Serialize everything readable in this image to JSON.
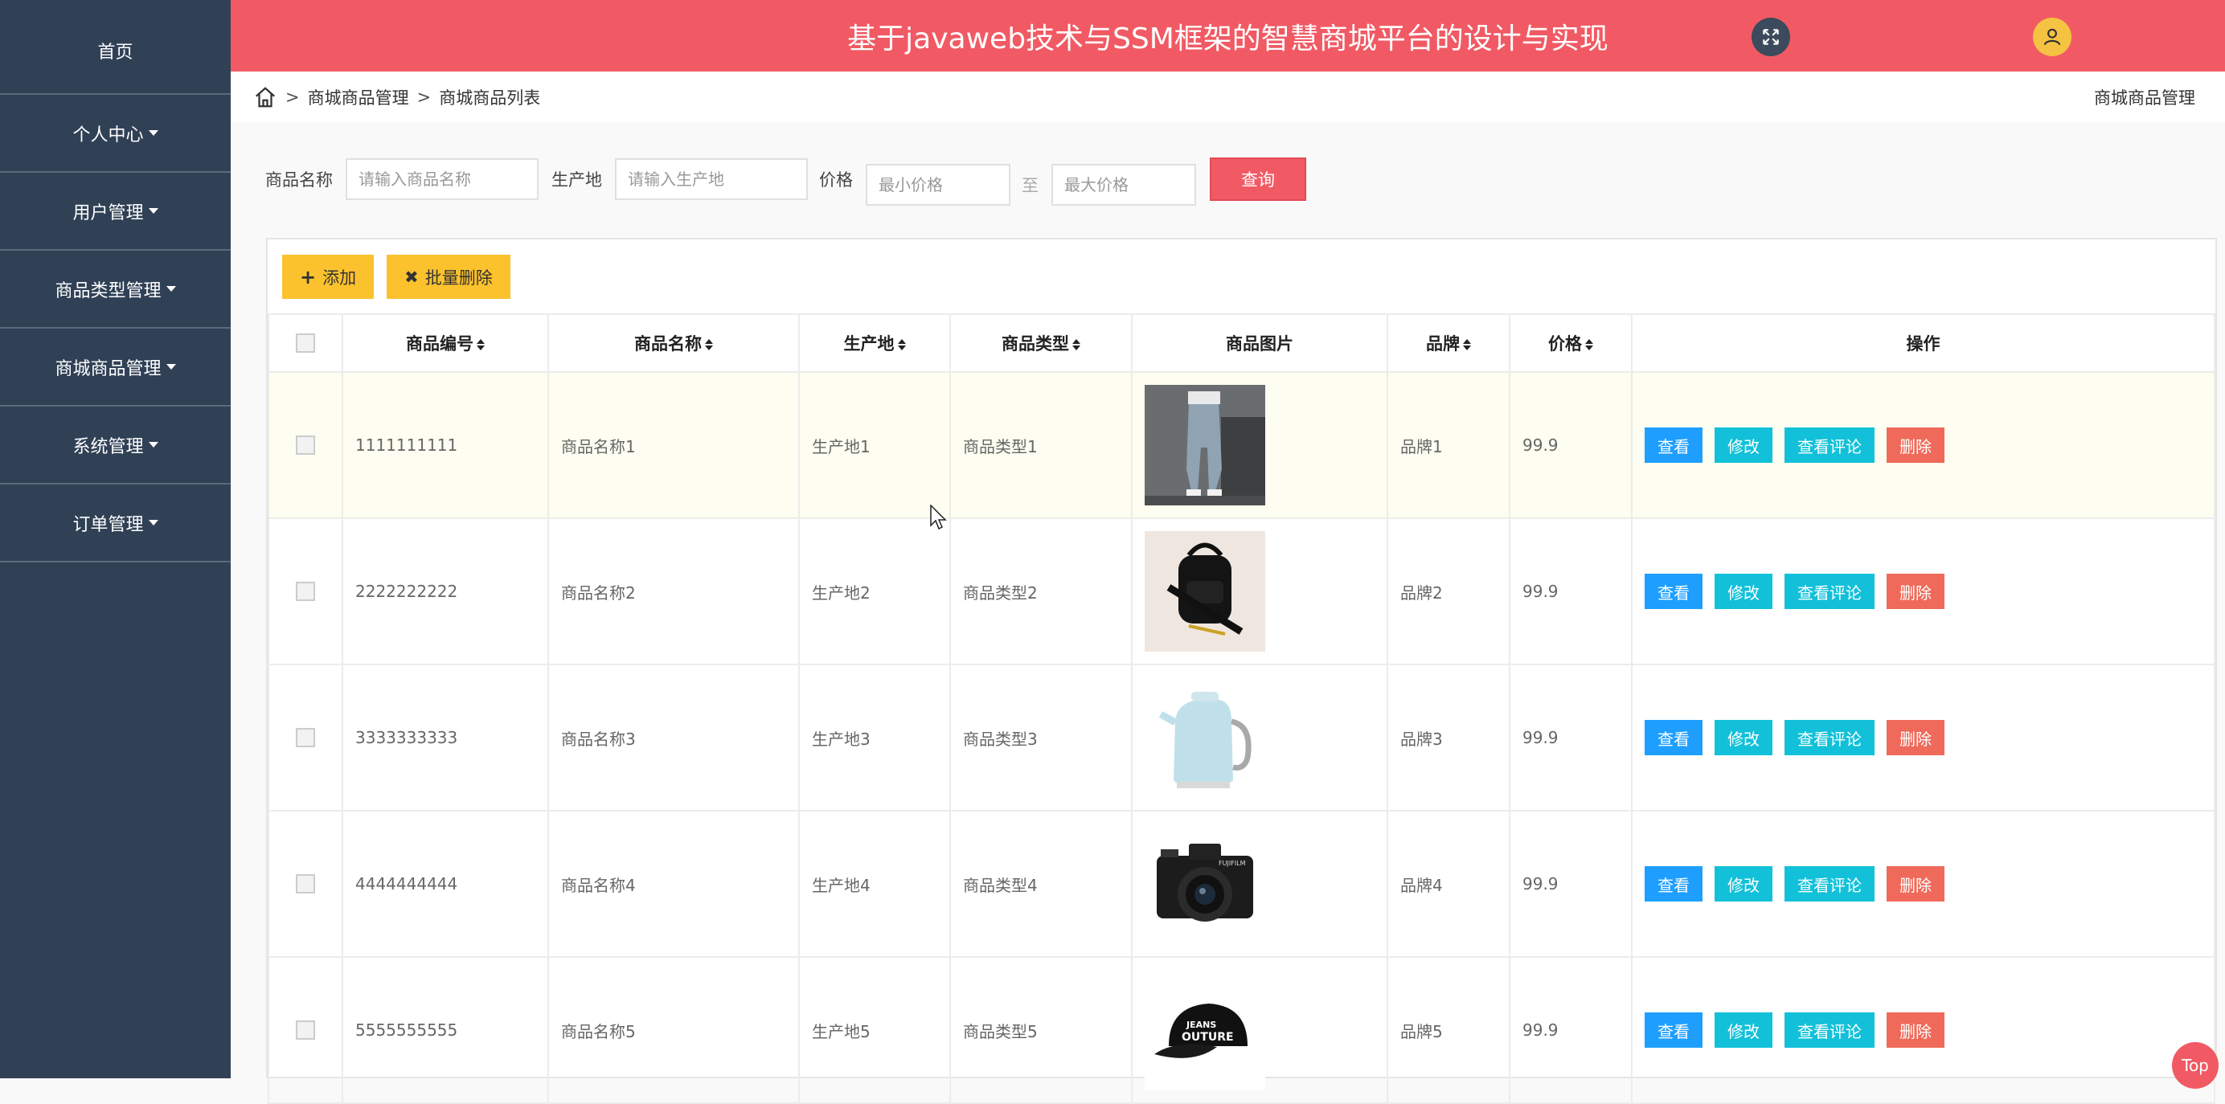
{
  "header": {
    "title": "基于javaweb技术与SSM框架的智慧商城平台的设计与实现"
  },
  "sidebar": {
    "items": [
      {
        "label": "首页",
        "dropdown": false
      },
      {
        "label": "个人中心",
        "dropdown": true
      },
      {
        "label": "用户管理",
        "dropdown": true
      },
      {
        "label": "商品类型管理",
        "dropdown": true
      },
      {
        "label": "商城商品管理",
        "dropdown": true
      },
      {
        "label": "系统管理",
        "dropdown": true
      },
      {
        "label": "订单管理",
        "dropdown": true
      }
    ]
  },
  "breadcrumb": {
    "items": [
      "商城商品管理",
      "商城商品列表"
    ],
    "separator": ">",
    "right": "商城商品管理"
  },
  "search": {
    "name_label": "商品名称",
    "name_placeholder": "请输入商品名称",
    "origin_label": "生产地",
    "origin_placeholder": "请输入生产地",
    "price_label": "价格",
    "min_placeholder": "最小价格",
    "to_label": "至",
    "max_placeholder": "最大价格",
    "query_button": "查询"
  },
  "actions": {
    "add_label": "添加",
    "batch_delete_label": "批量删除"
  },
  "table": {
    "headers": {
      "code": "商品编号",
      "name": "商品名称",
      "origin": "生产地",
      "type": "商品类型",
      "image": "商品图片",
      "brand": "品牌",
      "price": "价格",
      "ops": "操作"
    },
    "op_labels": {
      "view": "查看",
      "edit": "修改",
      "comments": "查看评论",
      "delete": "删除"
    },
    "rows": [
      {
        "code": "1111111111",
        "name": "商品名称1",
        "origin": "生产地1",
        "type": "商品类型1",
        "brand": "品牌1",
        "price": "99.9",
        "image": "jeans"
      },
      {
        "code": "2222222222",
        "name": "商品名称2",
        "origin": "生产地2",
        "type": "商品类型2",
        "brand": "品牌2",
        "price": "99.9",
        "image": "bag"
      },
      {
        "code": "3333333333",
        "name": "商品名称3",
        "origin": "生产地3",
        "type": "商品类型3",
        "brand": "品牌3",
        "price": "99.9",
        "image": "kettle"
      },
      {
        "code": "4444444444",
        "name": "商品名称4",
        "origin": "生产地4",
        "type": "商品类型4",
        "brand": "品牌4",
        "price": "99.9",
        "image": "camera"
      },
      {
        "code": "5555555555",
        "name": "商品名称5",
        "origin": "生产地5",
        "type": "商品类型5",
        "brand": "品牌5",
        "price": "99.9",
        "image": "cap"
      }
    ]
  },
  "back_to_top": "Top",
  "colors": {
    "sidebar": "#304156",
    "header": "#f15a64",
    "accent_yellow": "#fcc22d",
    "view": "#1e9fff",
    "edit": "#12c1d9",
    "delete": "#ef6a5a"
  }
}
